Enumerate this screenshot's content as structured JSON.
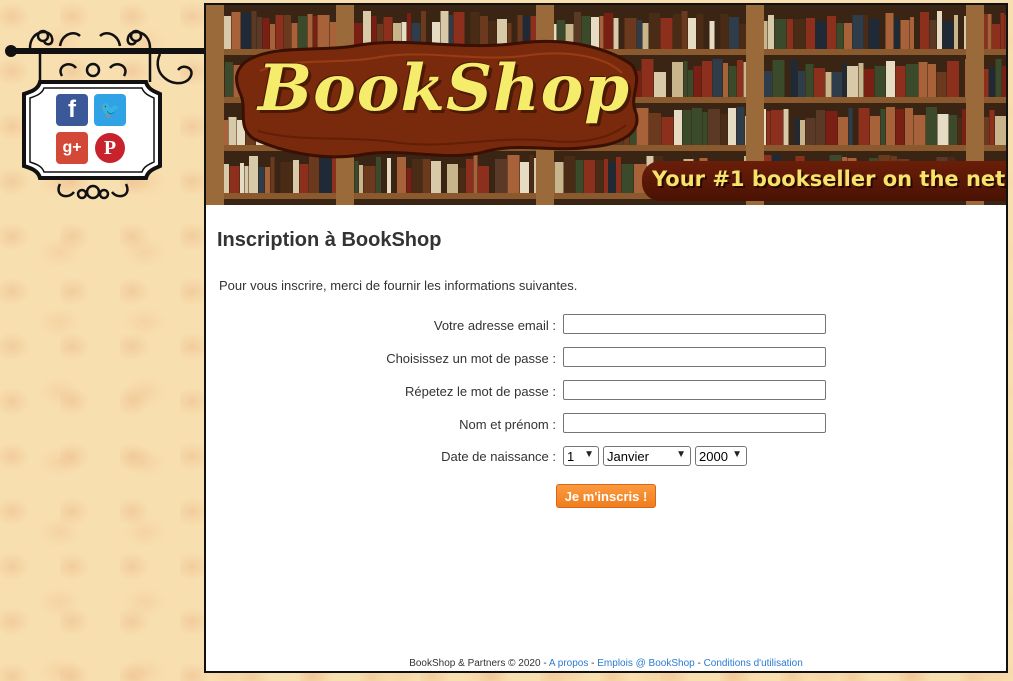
{
  "banner": {
    "logo": "BookShop",
    "tagline": "Your #1 bookseller on the net"
  },
  "social": {
    "facebook_glyph": "f",
    "twitter_glyph": "🐦",
    "googleplus_glyph": "g+",
    "pinterest_glyph": "P"
  },
  "page": {
    "title": "Inscription à BookShop",
    "intro": "Pour vous inscrire, merci de fournir les informations suivantes."
  },
  "form": {
    "email_label": "Votre adresse email :",
    "email_value": "",
    "password_label": "Choisissez un mot de passe :",
    "password_value": "",
    "password_repeat_label": "Répetez le mot de passe :",
    "password_repeat_value": "",
    "name_label": "Nom et prénom :",
    "name_value": "",
    "birthdate_label": "Date de naissance :",
    "day_selected": "1",
    "month_selected": "Janvier",
    "year_selected": "2000",
    "submit_label": "Je m'inscris !"
  },
  "footer": {
    "copyright": "BookShop & Partners © 2020",
    "separator": " - ",
    "link_about": "A propos",
    "link_jobs": "Emplois @ BookShop",
    "link_terms": "Conditions d'utilisation"
  },
  "colors": {
    "page_background": "#f8dfb0",
    "submit_button": "#f58a2a",
    "footer_links": "#2a7bd3",
    "tagline_text": "#f6e36a",
    "logo_text": "#f4ec6a"
  }
}
